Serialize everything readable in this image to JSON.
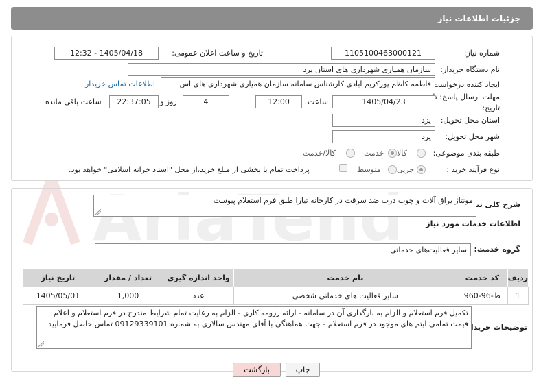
{
  "header": {
    "title": "جزئیات اطلاعات نیاز"
  },
  "form": {
    "need_number": {
      "label": "شماره نیاز:",
      "value": "1105100463000121"
    },
    "announce_datetime": {
      "label": "تاریخ و ساعت اعلان عمومی:",
      "value": "1405/04/18 - 12:32"
    },
    "buyer_org": {
      "label": "نام دستگاه خریدار:",
      "value": "سازمان همیاری شهرداری های استان یزد"
    },
    "requester": {
      "label": "ایجاد کننده درخواست:",
      "value": "فاطمه کاظم پورکریم آبادی کارشناس سامانه سازمان همیاری شهرداری های اس",
      "contact_link": "اطلاعات تماس خریدار"
    },
    "deadline": {
      "label_line1": "مهلت ارسال پاسخ: تا",
      "label_line2": "تاریخ:",
      "date": "1405/04/23",
      "time_label": "ساعت",
      "time": "12:00",
      "days": "4",
      "days_label": "روز و",
      "remaining": "22:37:05",
      "remaining_label": "ساعت باقی مانده"
    },
    "delivery_province": {
      "label": "استان محل تحویل:",
      "value": "یزد"
    },
    "delivery_city": {
      "label": "شهر محل تحویل:",
      "value": "یزد"
    },
    "category": {
      "label": "طبقه بندی موضوعی:",
      "options": [
        "کالا",
        "خدمت",
        "کالا/خدمت"
      ],
      "selected": "خدمت"
    },
    "process_type": {
      "label": "نوع فرآیند خرید :",
      "options": [
        "جزیی",
        "متوسط"
      ],
      "selected": "جزیی",
      "treasury_note": "پرداخت تمام یا بخشی از مبلغ خرید،از محل \"اسناد خزانه اسلامی\" خواهد بود."
    }
  },
  "details": {
    "need_desc_label": "شرح کلی نیاز:",
    "need_desc": "مونتاژ یراق آلات و چوب درب ضد سرقت در کارخانه تیارا طبق فرم استعلام پیوست",
    "services_info_title": "اطلاعات خدمات مورد نیاز",
    "service_group_label": "گروه خدمت:",
    "service_group": "سایر فعالیت‌های خدماتی",
    "table": {
      "headers": [
        "ردیف",
        "کد خدمت",
        "نام خدمت",
        "واحد اندازه گیری",
        "تعداد / مقدار",
        "تاریخ نیاز"
      ],
      "rows": [
        [
          "1",
          "ط-96-960",
          "سایر فعالیت های خدماتی شخصی",
          "عدد",
          "1,000",
          "1405/05/01"
        ]
      ]
    },
    "buyer_notes_label": "توضیحات خریدار:",
    "buyer_notes": "تکمیل فرم استعلام و الزام به بارگذاری آن در سامانه - ارائه رزومه کاری - الزام به رعایت تمام شرایط مندرج در فرم استعلام و اعلام قیمت تمامی ایتم های موجود در فرم استعلام - جهت هماهنگی با آقای مهندس سالاری  به شماره 09129339101 تماس حاصل فرمایید"
  },
  "actions": {
    "print_label": "چاپ",
    "back_label": "بازگشت"
  },
  "watermark": {
    "text": "AriaTender.neT"
  },
  "colors": {
    "header_bg": "#8d8d8d",
    "link": "#1b6aa8",
    "back_button_bg": "#f8d7d7"
  }
}
